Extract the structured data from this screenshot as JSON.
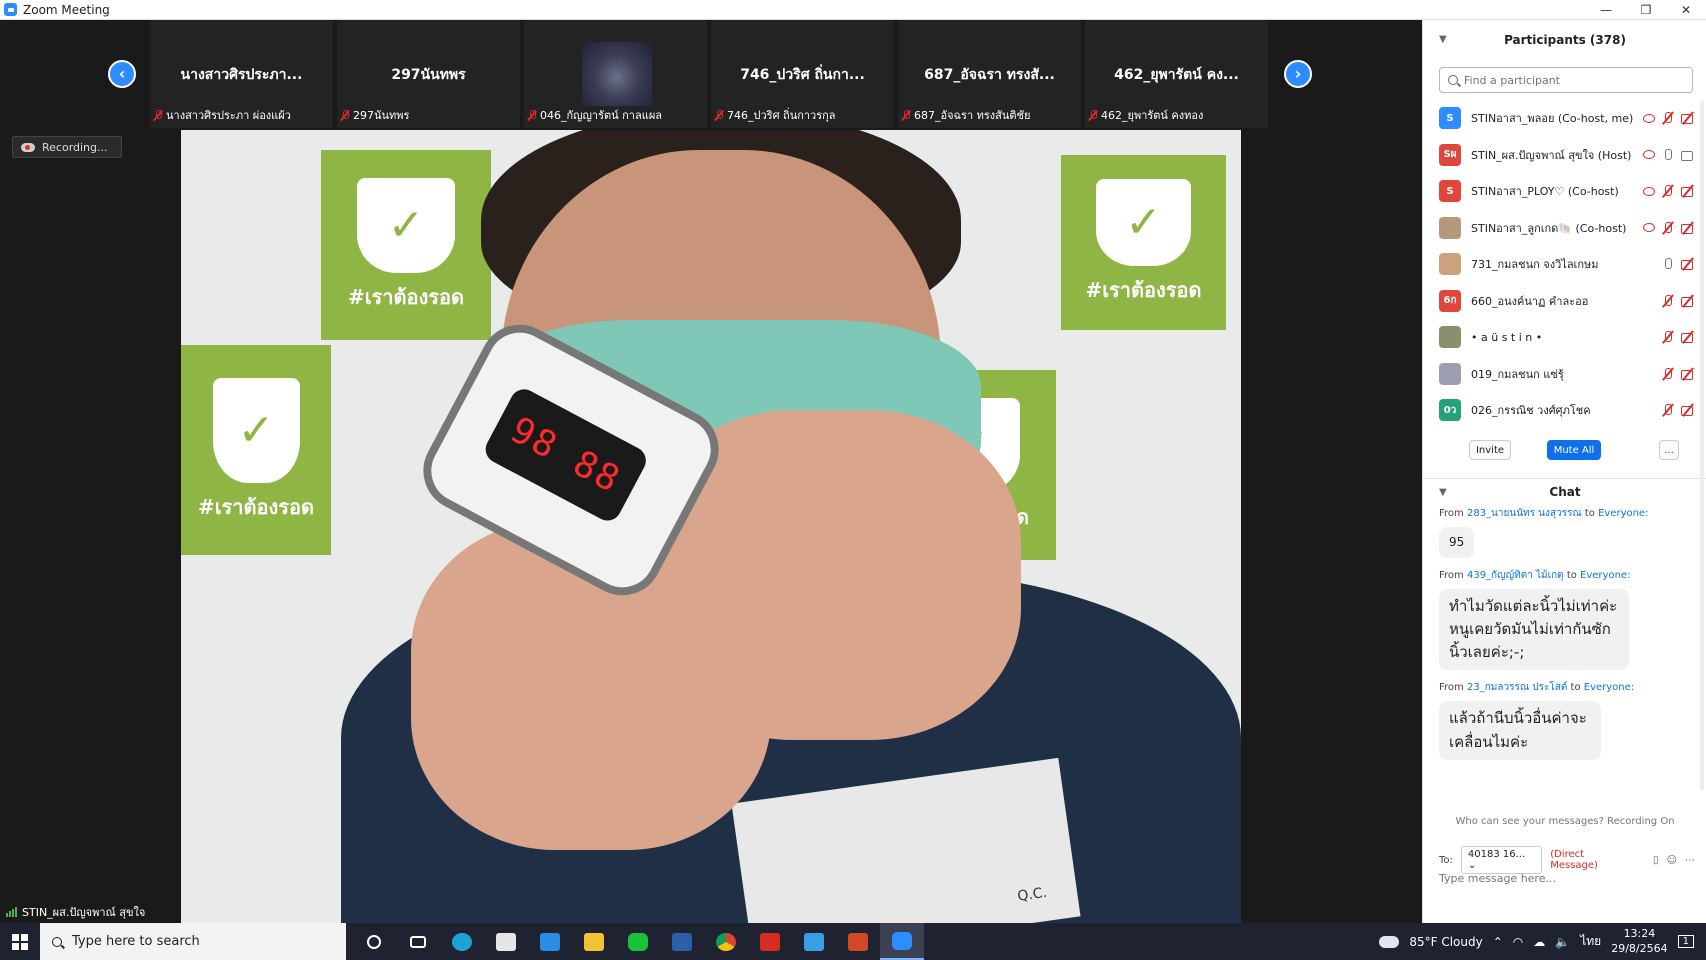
{
  "window": {
    "title": "Zoom Meeting",
    "minimize": "—",
    "restore": "❐",
    "close": "✕"
  },
  "strip": {
    "prev": "‹",
    "next": "›",
    "tiles": [
      {
        "name": "นางสาวศิรประภา...",
        "label": "นางสาวศิรประภา  ผ่องแผ้ว"
      },
      {
        "name": "297นันทพร",
        "label": "297นันทพร"
      },
      {
        "name": "",
        "label": "046_กัญญารัตน์ กาลแผล"
      },
      {
        "name": "746_ปวริศ ถิ่นกา...",
        "label": "746_ปวริศ ถิ่นกาวรกุล"
      },
      {
        "name": "687_อัจฉรา ทรงสั...",
        "label": "687_อัจฉรา ทรงสันติชัย"
      },
      {
        "name": "462_ยุพารัตน์ คง...",
        "label": "462_ยุพารัตน์ คงทอง"
      }
    ]
  },
  "recording": "Recording...",
  "video": {
    "poster_text": "#เราต้องรอด",
    "oximeter_digits": "98 88",
    "box_text": "Q.C.",
    "speaker": "STIN_ผส.ปัญจพาณ์ สุขใจ"
  },
  "participants": {
    "title": "Participants (378)",
    "search_placeholder": "Find a participant",
    "list": [
      {
        "initials": "S",
        "color": "#2d8cff",
        "name": "STINอาสา_พลอย (Co-host, me)"
      },
      {
        "initials": "Sผ",
        "color": "#e0463a",
        "name": "STIN_ผส.ปัญจพาณ์ สุขใจ (Host)"
      },
      {
        "initials": "S",
        "color": "#e0463a",
        "name": "STINอาสา_PLOY♡ (Co-host)"
      },
      {
        "initials": "",
        "color": "#b49a7a",
        "name": "STINอาสา_ลูกเกด🐚 (Co-host)"
      },
      {
        "initials": "",
        "color": "#caa27d",
        "name": "731_กมลชนก จงวิไลเกษม"
      },
      {
        "initials": "6ก",
        "color": "#e0463a",
        "name": "660_อนงค์นาฏ คำละออ"
      },
      {
        "initials": "",
        "color": "#8c8f6e",
        "name": "• a ü s t i n •"
      },
      {
        "initials": "",
        "color": "#9c9fb0",
        "name": "019_กมลชนก แซ่รุ้"
      },
      {
        "initials": "0ว",
        "color": "#22a37a",
        "name": "026_กรรณิช วงศ์ศุภโชค"
      }
    ],
    "invite": "Invite",
    "mute_all": "Mute All",
    "more": "..."
  },
  "chat": {
    "title": "Chat",
    "from": "From",
    "to": "to",
    "messages": [
      {
        "sender": "283_นายนนัทร นงสุวรรณ",
        "target": "Everyone:",
        "text": "95",
        "size": "small"
      },
      {
        "sender": "439_กัญญ์ทิตา ไม้เกตุ",
        "target": "Everyone:",
        "text": "ทำไมวัดแต่ละนิ้วไม่เท่าค่ะ หนูเคยวัดมันไม่เท่ากันซักนิ้วเลยค่ะ;-;",
        "size": "big"
      },
      {
        "sender": "23_กมลวรรณ ประโสต์",
        "target": "Everyone:",
        "text": "แล้วถ้านีบนิ้วอื่นค่าจะเคลื่อนไมค่ะ",
        "size": "big"
      }
    ],
    "who_can_see": "Who can see your messages? Recording On",
    "to_label": "To:",
    "to_value": "40183 16...",
    "direct": "(Direct Message)",
    "input_placeholder": "Type message here..."
  },
  "taskbar": {
    "search": "Type here to search",
    "weather": "85°F  Cloudy",
    "lang": "ไทย",
    "time": "13:24",
    "date": "29/8/2564",
    "notifications": "1"
  },
  "colors": {
    "accent": "#2d8cff",
    "mute_red": "#e02828",
    "poster_green": "#8fb545"
  }
}
